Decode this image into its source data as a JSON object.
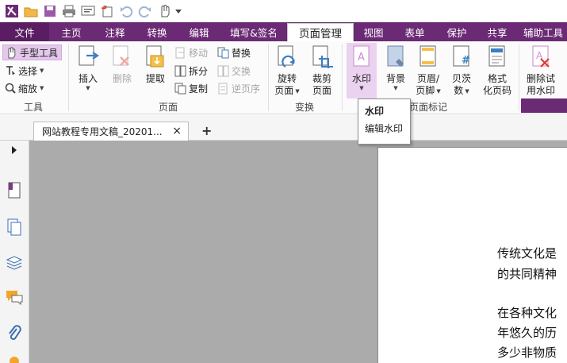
{
  "tabs": {
    "file": "文件",
    "items": [
      "主页",
      "注释",
      "转换",
      "编辑",
      "填写&签名",
      "页面管理",
      "视图",
      "表单",
      "保护",
      "共享",
      "辅助工具"
    ],
    "active_index": 5
  },
  "tools_group": {
    "label": "工具",
    "hand": "手型工具",
    "select": "选择",
    "zoom": "缩放"
  },
  "page_group": {
    "label": "页面",
    "insert": "插入",
    "delete": "删除",
    "extract": "提取",
    "move": "移动",
    "split": "拆分",
    "copy": "复制",
    "replace": "替换",
    "exchange": "交换",
    "reverse": "逆页序"
  },
  "transform_group": {
    "label": "变换",
    "rotate_1": "旋转",
    "rotate_2": "页面",
    "crop_1": "裁剪",
    "crop_2": "页面"
  },
  "mark_group": {
    "label": "页面标记",
    "watermark": "水印",
    "background": "背景",
    "header_1": "页眉/",
    "header_2": "页脚",
    "pagenum_1": "贝茨",
    "pagenum_2": "数",
    "format_1": "格式",
    "format_2": "化页码"
  },
  "trial_group": {
    "remove_1": "删除试",
    "remove_2": "用水印"
  },
  "dropdown": {
    "title": "水印",
    "edit": "编辑水印"
  },
  "doc_tab": {
    "title": "网站教程专用文稿_20201...",
    "close": "×",
    "new": "+"
  },
  "page_text": {
    "line1": "传统文化是",
    "line2": "的共同精神",
    "line3": "在各种文化",
    "line4": "年悠久的历",
    "line5": "多少非物质"
  },
  "colors": {
    "brand": "#6b2a74",
    "file_tab": "#5a1d63",
    "canvas": "#ababab"
  }
}
